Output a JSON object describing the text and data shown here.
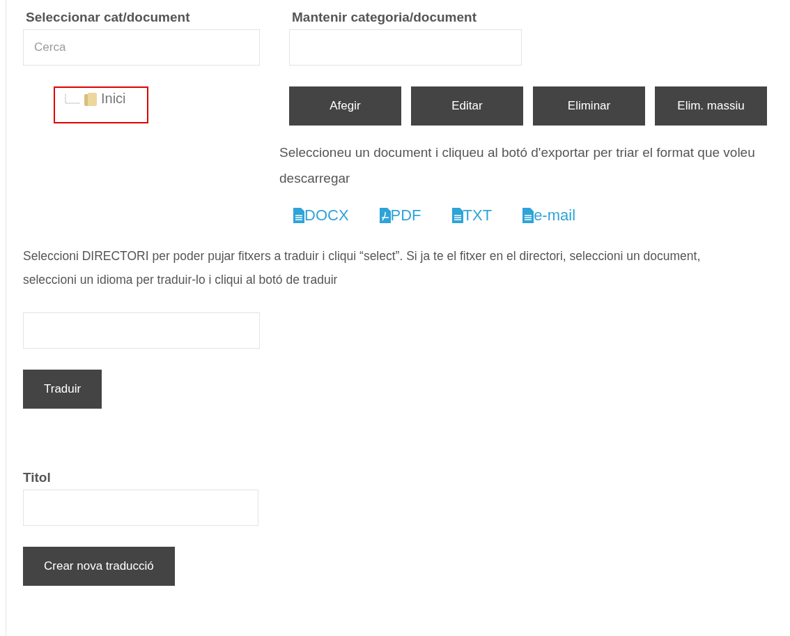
{
  "select_panel": {
    "heading": "Seleccionar cat/document",
    "search": {
      "placeholder": "Cerca"
    },
    "tree": [
      {
        "label": "Inici",
        "highlighted": true
      }
    ]
  },
  "maintain_panel": {
    "heading": "Mantenir categoria/document",
    "buttons": [
      "Afegir",
      "Editar",
      "Eliminar",
      "Elim. massiu"
    ],
    "export_hint": "Seleccioneu un document i cliqueu al botó d'exportar per triar el format que voleu descarregar",
    "export_links": [
      {
        "kind": "doc",
        "label": "DOCX"
      },
      {
        "kind": "pdf",
        "label": "PDF"
      },
      {
        "kind": "doc",
        "label": "TXT"
      },
      {
        "kind": "doc",
        "label": "e-mail"
      }
    ]
  },
  "translate": {
    "instructions": "Seleccioni DIRECTORI per poder pujar fitxers a traduir i cliqui “select”. Si ja te el fitxer en el directori, seleccioni un document, seleccioni un idioma per traduir-lo i cliqui al botó de traduir",
    "button": "Traduir"
  },
  "title_form": {
    "label": "Titol",
    "button": "Crear nova traducció"
  }
}
